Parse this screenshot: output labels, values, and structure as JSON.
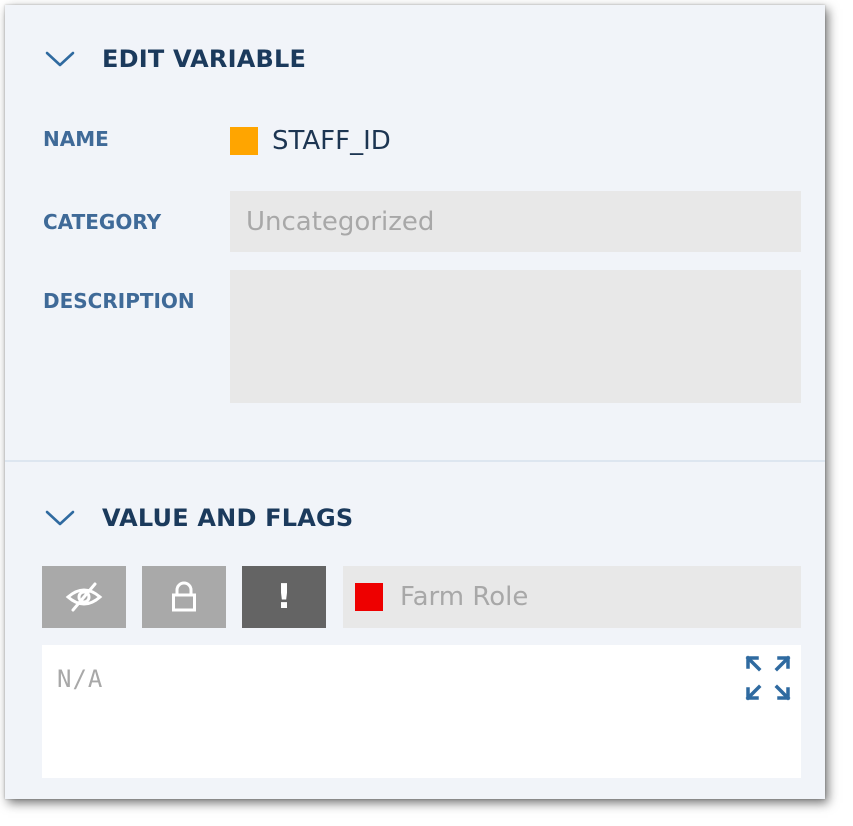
{
  "edit_variable": {
    "title": "EDIT VARIABLE",
    "name_label": "NAME",
    "name_value": "STAFF_ID",
    "name_color": "#ffa500",
    "category_label": "CATEGORY",
    "category_placeholder": "Uncategorized",
    "description_label": "DESCRIPTION",
    "description_value": ""
  },
  "value_and_flags": {
    "title": "VALUE AND FLAGS",
    "flags": [
      {
        "name": "hidden",
        "icon": "eye-slash-icon"
      },
      {
        "name": "locked",
        "icon": "lock-icon"
      },
      {
        "name": "required",
        "icon": "exclamation-icon",
        "symbol": "!"
      }
    ],
    "scope_label": "Farm Role",
    "scope_color": "#ee0000",
    "value_placeholder": "N/A",
    "expand_icon": "expand-icon"
  },
  "colors": {
    "panel_bg": "#f1f4f9",
    "header_text": "#1b3a5c",
    "label_text": "#3f6a98",
    "accent": "#2f6aa0"
  }
}
